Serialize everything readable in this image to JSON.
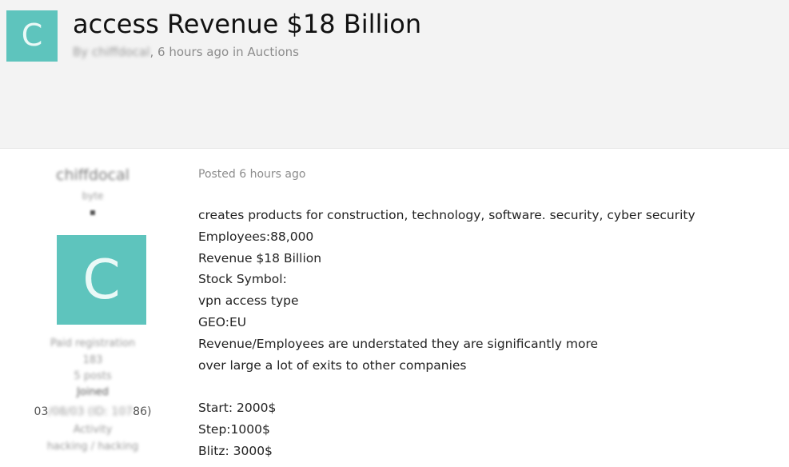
{
  "topic": {
    "title": "access Revenue $18 Billion",
    "author_prefix": "By",
    "author": "chiffdocal",
    "byline_suffix": ", 6 hours ago in Auctions",
    "avatar_letter": "C"
  },
  "author_panel": {
    "username": "chiffdocal",
    "title": "byte",
    "pip": "▪",
    "avatar_letter": "C",
    "registration": "Paid registration",
    "id": "183",
    "posts": "5 posts",
    "joined_label": "Joined",
    "joined_date_prefix": "03",
    "joined_date_hidden": "/08/03 (ID: 107",
    "joined_date_suffix": "86)",
    "activity_label": "Activity",
    "activity_value": "hacking / hacking"
  },
  "post": {
    "posted": "Posted 6 hours ago",
    "lines": [
      "creates products for construction, technology, software. security, cyber security",
      "Employees:88,000",
      "Revenue $18 Billion",
      "Stock Symbol:",
      "vpn access type",
      "GEO:EU",
      "Revenue/Employees are understated they are significantly more",
      "over large a lot of exits to other companies",
      "",
      "Start: 2000$",
      "Step:1000$",
      "Blitz: 3000$"
    ]
  },
  "colors": {
    "avatar_bg": "#5ec4bd",
    "header_bg": "#f3f3f3"
  }
}
